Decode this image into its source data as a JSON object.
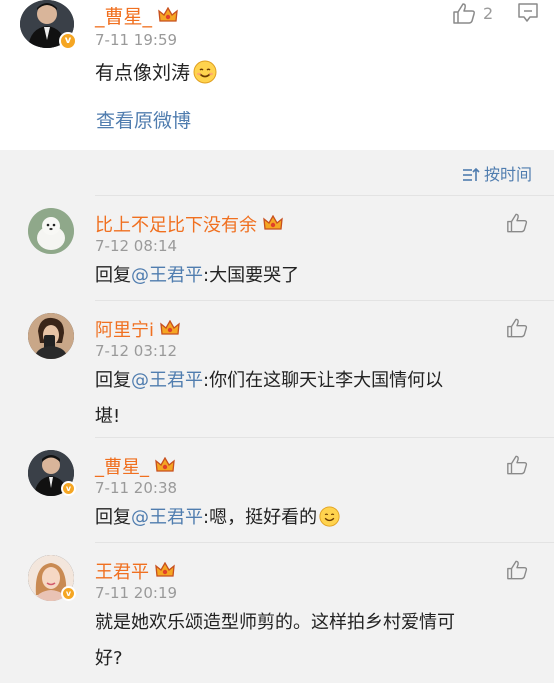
{
  "post": {
    "username": "_曹星_",
    "time": "7-11 19:59",
    "text": "有点像刘涛",
    "like_count": "2",
    "view_original": "查看原微博"
  },
  "sort_label": "按时间",
  "comments": [
    {
      "username": "比上不足比下没有余",
      "time": "7-12 08:14",
      "reply_prefix": "回复",
      "mention": "@王君平",
      "text": ":大国要哭了",
      "verified": false
    },
    {
      "username": "阿里宁i",
      "time": "7-12 03:12",
      "reply_prefix": "回复",
      "mention": "@王君平",
      "text": ":你们在这聊天让李大国情何以",
      "text2": "堪!",
      "verified": false
    },
    {
      "username": "_曹星_",
      "time": "7-11 20:38",
      "reply_prefix": "回复",
      "mention": "@王君平",
      "text": ":嗯，挺好看的",
      "verified": true
    },
    {
      "username": "王君平",
      "time": "7-11 20:19",
      "text": "就是她欢乐颂造型师剪的。这样拍乡村爱情可",
      "text2": "好?",
      "verified": true
    }
  ],
  "colors": {
    "username": "#f07020",
    "link": "#507daf",
    "time": "#9a9a9a",
    "badge": "#f5a623",
    "background_band": "#f2f2f2"
  }
}
